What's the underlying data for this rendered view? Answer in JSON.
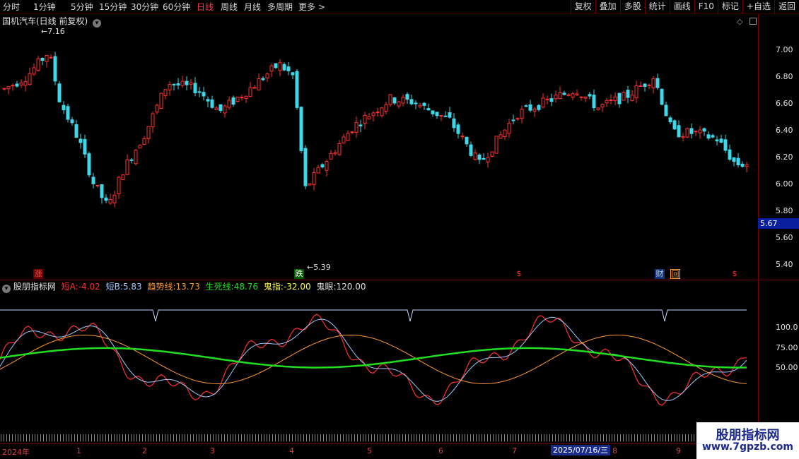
{
  "toolbar": {
    "periods": [
      {
        "label": "分时",
        "active": false
      },
      {
        "label": "1分钟",
        "active": false
      },
      {
        "label": "5分钟",
        "active": false
      },
      {
        "label": "15分钟",
        "active": false
      },
      {
        "label": "30分钟",
        "active": false
      },
      {
        "label": "60分钟",
        "active": false
      },
      {
        "label": "日线",
        "active": true
      },
      {
        "label": "周线",
        "active": false
      },
      {
        "label": "月线",
        "active": false
      },
      {
        "label": "多周期",
        "active": false
      },
      {
        "label": "更多 >",
        "active": false
      }
    ],
    "right_buttons": [
      "复权",
      "叠加",
      "多股",
      "统计",
      "画线",
      "F10",
      "标记",
      "+自选",
      "返回"
    ]
  },
  "main_chart": {
    "title": "国机汽车(日线 前复权)",
    "high_label": "7.16",
    "low_label": "5.39",
    "price_axis": [
      "7.00",
      "6.80",
      "6.60",
      "6.40",
      "6.20",
      "6.00",
      "5.80",
      "5.60",
      "5.40"
    ],
    "current_price": "5.67",
    "markers": {
      "zhang": "涨",
      "die": "跌",
      "cai": "财",
      "hui": "回",
      "s": "$"
    }
  },
  "indicator": {
    "name": "股朋指标网",
    "items": [
      {
        "label": "短A:",
        "value": "-4.02",
        "color": "#ff3030"
      },
      {
        "label": "短B:",
        "value": "5.83",
        "color": "#9ec9ff"
      },
      {
        "label": "趋势线:",
        "value": "13.73",
        "color": "#ff9a30"
      },
      {
        "label": "生死线:",
        "value": "48.76",
        "color": "#20e020"
      },
      {
        "label": "鬼指:",
        "value": "-32.00",
        "color": "#ffff40"
      },
      {
        "label": "鬼眼:",
        "value": "120.00",
        "color": "#e0e0e0"
      }
    ],
    "axis": [
      "100.0",
      "75.00",
      "50.00"
    ]
  },
  "xaxis": {
    "year": "2024年",
    "months": [
      "1",
      "2",
      "3",
      "4",
      "5",
      "6",
      "7",
      "8",
      "9"
    ],
    "highlight_date": "2025/07/16/三"
  },
  "watermark": {
    "title": "股朋指标网",
    "url": "www.7gpzb.com"
  },
  "colors": {
    "up": "#ff3030",
    "down": "#3fd8e8",
    "trend": "#ff9a30",
    "life": "#20e020",
    "shortB": "#9ec9ff"
  }
}
